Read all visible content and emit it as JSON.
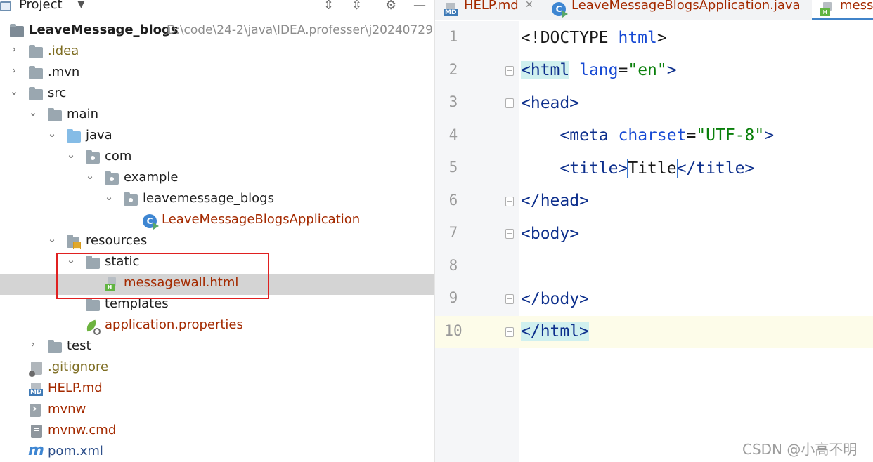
{
  "panel": {
    "title": "Project",
    "dropdown_icon": "chevron-down-icon",
    "toolbar_icons": [
      "expand-all-icon",
      "collapse-all-icon",
      "gear-icon",
      "minimize-icon"
    ]
  },
  "tree": {
    "root_name": "LeaveMessage_blogs",
    "root_path": "D:\\code\\24-2\\java\\IDEA.professer\\j20240729",
    "idea": ".idea",
    "mvn": ".mvn",
    "src": "src",
    "main": "main",
    "java": "java",
    "com": "com",
    "example": "example",
    "pkg": "leavemessage_blogs",
    "app_class": "LeaveMessageBlogsApplication",
    "resources": "resources",
    "static": "static",
    "messagewall": "messagewall.html",
    "templates": "templates",
    "app_props": "application.properties",
    "test": "test",
    "gitignore": ".gitignore",
    "help": "HELP.md",
    "mvnw": "mvnw",
    "mvnw_cmd": "mvnw.cmd",
    "pom": "pom.xml"
  },
  "tabs": [
    {
      "label": "HELP.md",
      "icon": "markdown-file-icon"
    },
    {
      "label": "LeaveMessageBlogsApplication.java",
      "icon": "java-class-icon"
    },
    {
      "label": "messa",
      "icon": "html-file-icon"
    }
  ],
  "editor": {
    "line_numbers": [
      "1",
      "2",
      "3",
      "4",
      "5",
      "6",
      "7",
      "8",
      "9",
      "10"
    ],
    "current_line": 10,
    "code": {
      "l1_doctype": "<!DOCTYPE",
      "l1_html": "html",
      "l1_close": ">",
      "l2_open": "<html",
      "l2_attr": "lang",
      "l2_eq": "=",
      "l2_val": "\"en\"",
      "l2_close": ">",
      "l3_head": "<head>",
      "l4_meta": "<meta",
      "l4_attr": "charset",
      "l4_eq": "=",
      "l4_val": "\"UTF-8\"",
      "l4_close": ">",
      "l5_open": "<title>",
      "l5_text": "Title",
      "l5_close": "</title>",
      "l6_head_close": "</head>",
      "l7_body": "<body>",
      "l9_body_close": "</body>",
      "l10_html_close": "</html>"
    }
  },
  "watermark": "CSDN @小高不明",
  "colors": {
    "selection": "#d4d4d4",
    "highlight_box": "#e02020",
    "tag_blue": "#0d2f8c",
    "string_green": "#097f0a",
    "current_line": "#fdfce9"
  }
}
